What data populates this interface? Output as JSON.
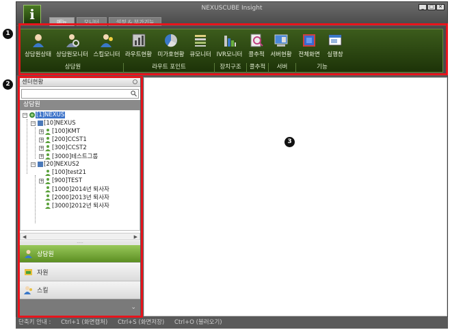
{
  "window": {
    "title": "NEXUSCUBE Insight",
    "logo_letter": "i",
    "controls": [
      "_",
      "□",
      "✕"
    ]
  },
  "tabs": [
    {
      "label": "메뉴",
      "active": true
    },
    {
      "label": "모니터",
      "active": false
    },
    {
      "label": "설정 & 부가기능",
      "active": false
    }
  ],
  "ribbon": {
    "buttons": [
      {
        "label": "상담원상태",
        "icon": "agent-status-icon"
      },
      {
        "label": "상담원모니터",
        "icon": "agent-monitor-icon"
      },
      {
        "label": "스킬모니터",
        "icon": "skill-monitor-icon"
      },
      {
        "label": "라우트현황",
        "icon": "route-status-icon"
      },
      {
        "label": "미가호현황",
        "icon": "pie-chart-icon"
      },
      {
        "label": "큐모니터",
        "icon": "queue-monitor-icon"
      },
      {
        "label": "IVR모니터",
        "icon": "ivr-monitor-icon"
      },
      {
        "label": "콜추적",
        "icon": "call-trace-icon"
      },
      {
        "label": "서버현황",
        "icon": "server-status-icon"
      },
      {
        "label": "전체화면",
        "icon": "fullscreen-icon"
      },
      {
        "label": "실행창",
        "icon": "run-window-icon"
      }
    ],
    "groups": [
      "상담원",
      "라우트 포인트",
      "장치구조",
      "콜추적",
      "서버",
      "기능"
    ]
  },
  "callouts": [
    "1",
    "2",
    "3"
  ],
  "left_panel": {
    "header": "센터현황",
    "search_placeholder": "",
    "tree_caption": "상담원",
    "tree": [
      {
        "label": "[1]NEXUS",
        "selected": true
      },
      {
        "label": "[10]NEXUS"
      },
      {
        "label": "[100]KMT"
      },
      {
        "label": "[200]CCST1"
      },
      {
        "label": "[300]CCST2"
      },
      {
        "label": "[3000]테스트그룹"
      },
      {
        "label": "[20]NEXUS2"
      },
      {
        "label": "[100]test21"
      },
      {
        "label": "[900]TEST"
      },
      {
        "label": "[1000]2014년 퇴사자"
      },
      {
        "label": "[2000]2013년 퇴사자"
      },
      {
        "label": "[3000]2012년 퇴사자"
      }
    ],
    "nav": [
      {
        "label": "상담원",
        "active": true
      },
      {
        "label": "자원",
        "active": false
      },
      {
        "label": "스킬",
        "active": false
      }
    ]
  },
  "statusbar": {
    "label": "단축키 안내 :",
    "items": [
      "Ctrl+1 (화면캡처)",
      "Ctrl+S (화면저장)",
      "Ctrl+O (불러오기)"
    ]
  }
}
